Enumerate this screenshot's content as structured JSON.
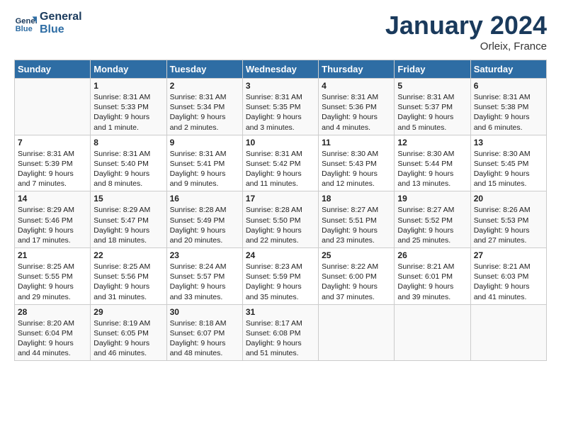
{
  "header": {
    "logo_line1": "General",
    "logo_line2": "Blue",
    "month": "January 2024",
    "location": "Orleix, France"
  },
  "days_of_week": [
    "Sunday",
    "Monday",
    "Tuesday",
    "Wednesday",
    "Thursday",
    "Friday",
    "Saturday"
  ],
  "weeks": [
    [
      {
        "day": "",
        "content": ""
      },
      {
        "day": "1",
        "content": "Sunrise: 8:31 AM\nSunset: 5:33 PM\nDaylight: 9 hours\nand 1 minute."
      },
      {
        "day": "2",
        "content": "Sunrise: 8:31 AM\nSunset: 5:34 PM\nDaylight: 9 hours\nand 2 minutes."
      },
      {
        "day": "3",
        "content": "Sunrise: 8:31 AM\nSunset: 5:35 PM\nDaylight: 9 hours\nand 3 minutes."
      },
      {
        "day": "4",
        "content": "Sunrise: 8:31 AM\nSunset: 5:36 PM\nDaylight: 9 hours\nand 4 minutes."
      },
      {
        "day": "5",
        "content": "Sunrise: 8:31 AM\nSunset: 5:37 PM\nDaylight: 9 hours\nand 5 minutes."
      },
      {
        "day": "6",
        "content": "Sunrise: 8:31 AM\nSunset: 5:38 PM\nDaylight: 9 hours\nand 6 minutes."
      }
    ],
    [
      {
        "day": "7",
        "content": "Sunrise: 8:31 AM\nSunset: 5:39 PM\nDaylight: 9 hours\nand 7 minutes."
      },
      {
        "day": "8",
        "content": "Sunrise: 8:31 AM\nSunset: 5:40 PM\nDaylight: 9 hours\nand 8 minutes."
      },
      {
        "day": "9",
        "content": "Sunrise: 8:31 AM\nSunset: 5:41 PM\nDaylight: 9 hours\nand 9 minutes."
      },
      {
        "day": "10",
        "content": "Sunrise: 8:31 AM\nSunset: 5:42 PM\nDaylight: 9 hours\nand 11 minutes."
      },
      {
        "day": "11",
        "content": "Sunrise: 8:30 AM\nSunset: 5:43 PM\nDaylight: 9 hours\nand 12 minutes."
      },
      {
        "day": "12",
        "content": "Sunrise: 8:30 AM\nSunset: 5:44 PM\nDaylight: 9 hours\nand 13 minutes."
      },
      {
        "day": "13",
        "content": "Sunrise: 8:30 AM\nSunset: 5:45 PM\nDaylight: 9 hours\nand 15 minutes."
      }
    ],
    [
      {
        "day": "14",
        "content": "Sunrise: 8:29 AM\nSunset: 5:46 PM\nDaylight: 9 hours\nand 17 minutes."
      },
      {
        "day": "15",
        "content": "Sunrise: 8:29 AM\nSunset: 5:47 PM\nDaylight: 9 hours\nand 18 minutes."
      },
      {
        "day": "16",
        "content": "Sunrise: 8:28 AM\nSunset: 5:49 PM\nDaylight: 9 hours\nand 20 minutes."
      },
      {
        "day": "17",
        "content": "Sunrise: 8:28 AM\nSunset: 5:50 PM\nDaylight: 9 hours\nand 22 minutes."
      },
      {
        "day": "18",
        "content": "Sunrise: 8:27 AM\nSunset: 5:51 PM\nDaylight: 9 hours\nand 23 minutes."
      },
      {
        "day": "19",
        "content": "Sunrise: 8:27 AM\nSunset: 5:52 PM\nDaylight: 9 hours\nand 25 minutes."
      },
      {
        "day": "20",
        "content": "Sunrise: 8:26 AM\nSunset: 5:53 PM\nDaylight: 9 hours\nand 27 minutes."
      }
    ],
    [
      {
        "day": "21",
        "content": "Sunrise: 8:25 AM\nSunset: 5:55 PM\nDaylight: 9 hours\nand 29 minutes."
      },
      {
        "day": "22",
        "content": "Sunrise: 8:25 AM\nSunset: 5:56 PM\nDaylight: 9 hours\nand 31 minutes."
      },
      {
        "day": "23",
        "content": "Sunrise: 8:24 AM\nSunset: 5:57 PM\nDaylight: 9 hours\nand 33 minutes."
      },
      {
        "day": "24",
        "content": "Sunrise: 8:23 AM\nSunset: 5:59 PM\nDaylight: 9 hours\nand 35 minutes."
      },
      {
        "day": "25",
        "content": "Sunrise: 8:22 AM\nSunset: 6:00 PM\nDaylight: 9 hours\nand 37 minutes."
      },
      {
        "day": "26",
        "content": "Sunrise: 8:21 AM\nSunset: 6:01 PM\nDaylight: 9 hours\nand 39 minutes."
      },
      {
        "day": "27",
        "content": "Sunrise: 8:21 AM\nSunset: 6:03 PM\nDaylight: 9 hours\nand 41 minutes."
      }
    ],
    [
      {
        "day": "28",
        "content": "Sunrise: 8:20 AM\nSunset: 6:04 PM\nDaylight: 9 hours\nand 44 minutes."
      },
      {
        "day": "29",
        "content": "Sunrise: 8:19 AM\nSunset: 6:05 PM\nDaylight: 9 hours\nand 46 minutes."
      },
      {
        "day": "30",
        "content": "Sunrise: 8:18 AM\nSunset: 6:07 PM\nDaylight: 9 hours\nand 48 minutes."
      },
      {
        "day": "31",
        "content": "Sunrise: 8:17 AM\nSunset: 6:08 PM\nDaylight: 9 hours\nand 51 minutes."
      },
      {
        "day": "",
        "content": ""
      },
      {
        "day": "",
        "content": ""
      },
      {
        "day": "",
        "content": ""
      }
    ]
  ]
}
